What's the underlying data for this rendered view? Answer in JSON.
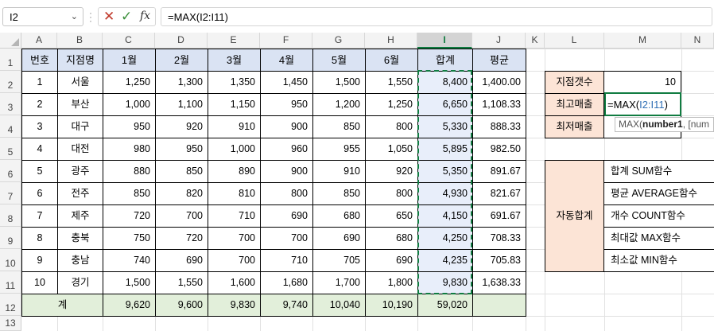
{
  "formula_bar": {
    "name_box": "I2",
    "formula": "=MAX(I2:I11)"
  },
  "columns": [
    "A",
    "B",
    "C",
    "D",
    "E",
    "F",
    "G",
    "H",
    "I",
    "J",
    "K",
    "L",
    "M",
    "N"
  ],
  "rows": [
    "1",
    "2",
    "3",
    "4",
    "5",
    "6",
    "7",
    "8",
    "9",
    "10",
    "11",
    "12",
    "13"
  ],
  "table": {
    "headers": [
      "번호",
      "지점명",
      "1월",
      "2월",
      "3월",
      "4월",
      "5월",
      "6월",
      "합계",
      "평균"
    ],
    "rows": [
      [
        "1",
        "서울",
        "1,250",
        "1,300",
        "1,350",
        "1,450",
        "1,500",
        "1,550",
        "8,400",
        "1,400.00"
      ],
      [
        "2",
        "부산",
        "1,000",
        "1,100",
        "1,150",
        "950",
        "1,200",
        "1,250",
        "6,650",
        "1,108.33"
      ],
      [
        "3",
        "대구",
        "950",
        "920",
        "910",
        "900",
        "850",
        "800",
        "5,330",
        "888.33"
      ],
      [
        "4",
        "대전",
        "980",
        "950",
        "1,000",
        "960",
        "955",
        "1,050",
        "5,895",
        "982.50"
      ],
      [
        "5",
        "광주",
        "880",
        "850",
        "890",
        "900",
        "910",
        "920",
        "5,350",
        "891.67"
      ],
      [
        "6",
        "전주",
        "850",
        "820",
        "810",
        "800",
        "850",
        "800",
        "4,930",
        "821.67"
      ],
      [
        "7",
        "제주",
        "720",
        "700",
        "710",
        "690",
        "680",
        "650",
        "4,150",
        "691.67"
      ],
      [
        "8",
        "충북",
        "750",
        "720",
        "700",
        "700",
        "690",
        "680",
        "4,250",
        "708.33"
      ],
      [
        "9",
        "충남",
        "740",
        "690",
        "700",
        "710",
        "705",
        "690",
        "4,235",
        "705.83"
      ],
      [
        "10",
        "경기",
        "1,500",
        "1,550",
        "1,600",
        "1,680",
        "1,700",
        "1,800",
        "9,830",
        "1,638.33"
      ]
    ],
    "total_label": "계",
    "totals": [
      "9,620",
      "9,600",
      "9,830",
      "9,740",
      "10,040",
      "10,190",
      "59,020"
    ]
  },
  "summary": {
    "labels": [
      "지점갯수",
      "최고매출",
      "최저매출"
    ],
    "count_value": "10",
    "editing_formula_prefix": "=MAX(",
    "editing_formula_ref": "I2:I11",
    "editing_formula_suffix": ")",
    "tooltip_func": "MAX(",
    "tooltip_arg": "number1",
    "tooltip_rest": ", [num"
  },
  "functions_box": {
    "label": "자동합계",
    "items": [
      "합계 SUM함수",
      "평균 AVERAGE함수",
      "개수 COUNT함수",
      "최대값 MAX함수",
      "최소값 MIN함수"
    ]
  },
  "colors": {
    "header_fill": "#dae3f3",
    "total_fill": "#e2efda",
    "label_fill": "#fce4d6",
    "accent": "#107c41"
  }
}
